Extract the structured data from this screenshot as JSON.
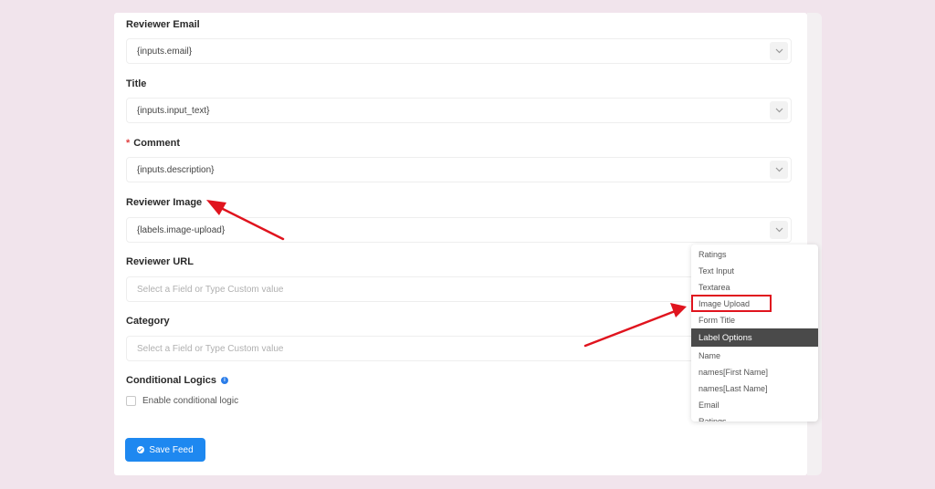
{
  "form": {
    "fields": [
      {
        "label": "Reviewer Email",
        "required": false,
        "value": "{inputs.email}",
        "placeholder": ""
      },
      {
        "label": "Title",
        "required": false,
        "value": "{inputs.input_text}",
        "placeholder": ""
      },
      {
        "label": "Comment",
        "required": true,
        "value": "{inputs.description}",
        "placeholder": ""
      },
      {
        "label": "Reviewer Image",
        "required": false,
        "value": "{labels.image-upload}",
        "placeholder": ""
      },
      {
        "label": "Reviewer URL",
        "required": false,
        "value": "",
        "placeholder": "Select a Field or Type Custom value"
      },
      {
        "label": "Category",
        "required": false,
        "value": "",
        "placeholder": "Select a Field or Type Custom value"
      }
    ],
    "required_marker": "*",
    "conditional": {
      "label": "Conditional Logics",
      "info_icon": "i",
      "checkbox_label": "Enable conditional logic",
      "checked": false
    },
    "save_label": "Save Feed"
  },
  "dropdown": {
    "items_before": [
      "Ratings",
      "Text Input",
      "Textarea",
      "Image Upload",
      "Form Title"
    ],
    "group_label": "Label Options",
    "items_after": [
      "Name",
      "names[First Name]",
      "names[Last Name]",
      "Email",
      "Ratings"
    ],
    "highlighted": "Image Upload"
  },
  "annotation_color": "#e0141e",
  "accent_color": "#1e88f0"
}
